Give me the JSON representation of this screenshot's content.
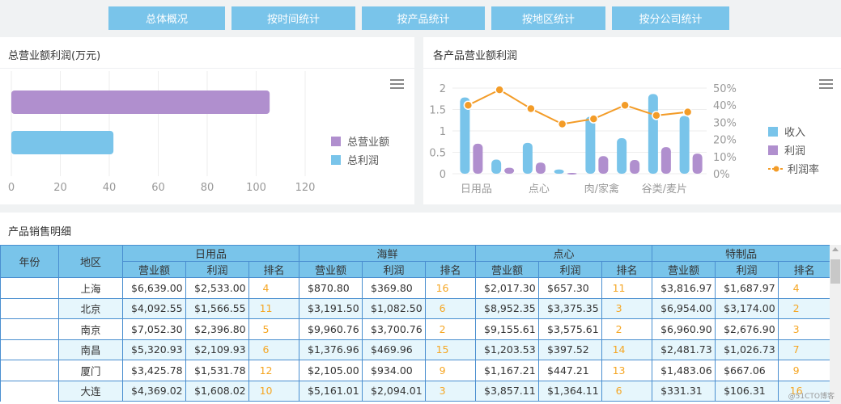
{
  "nav": {
    "buttons": [
      "总体概况",
      "按时间统计",
      "按产品统计",
      "按地区统计",
      "按分公司统计"
    ]
  },
  "left_panel": {
    "title": "总营业额利润(万元)"
  },
  "right_panel": {
    "title": "各产品营业额利润"
  },
  "table_panel": {
    "title": "产品销售明细"
  },
  "chart_data": [
    {
      "type": "bar",
      "orientation": "horizontal",
      "title": "总营业额利润(万元)",
      "categories": [
        "总营业额",
        "总利润"
      ],
      "values": [
        105.5,
        41.7
      ],
      "colors": [
        "#b08fce",
        "#79c4ea"
      ],
      "xlim": [
        0,
        120
      ],
      "x_ticks": [
        "0",
        "20",
        "40",
        "60",
        "80",
        "100",
        "120"
      ],
      "legend": [
        "总营业额",
        "总利润"
      ],
      "legend_position": "right",
      "grid": true
    },
    {
      "type": "bar",
      "title": "各产品营业额利润",
      "categories": [
        "日用品",
        "",
        "点心",
        "",
        "肉/家禽",
        "",
        "谷类/麦片",
        ""
      ],
      "series": [
        {
          "name": "收入",
          "type": "bar",
          "axis": "left",
          "color": "#79c4ea",
          "values": [
            1.78,
            0.33,
            0.72,
            0.1,
            1.33,
            0.83,
            1.86,
            1.35
          ]
        },
        {
          "name": "利润",
          "type": "bar",
          "axis": "left",
          "color": "#b08fce",
          "values": [
            0.7,
            0.14,
            0.26,
            0.02,
            0.41,
            0.32,
            0.62,
            0.47
          ]
        },
        {
          "name": "利润率",
          "type": "line",
          "axis": "right",
          "color": "#f39c28",
          "values": [
            40,
            49,
            38,
            29,
            32,
            40,
            34,
            36
          ]
        }
      ],
      "ylim_left": [
        0,
        2
      ],
      "y_ticks_left": [
        "0",
        "0.5",
        "1",
        "1.5",
        "2"
      ],
      "ylim_right": [
        0,
        50
      ],
      "y_ticks_right": [
        "0%",
        "10%",
        "20%",
        "30%",
        "40%",
        "50%"
      ],
      "legend": [
        "收入",
        "利润",
        "利润率"
      ],
      "legend_position": "right",
      "grid": true
    }
  ],
  "table": {
    "header_year": "年份",
    "header_region": "地区",
    "groups": [
      "日用品",
      "海鲜",
      "点心",
      "特制品"
    ],
    "sub_headers": [
      "营业额",
      "利润",
      "排名"
    ],
    "rows": [
      {
        "region": "上海",
        "cells": [
          [
            "$6,639.00",
            "$2,533.00",
            "4"
          ],
          [
            "$870.80",
            "$369.80",
            "16"
          ],
          [
            "$2,017.30",
            "$657.30",
            "11"
          ],
          [
            "$3,816.97",
            "$1,687.97",
            "4"
          ]
        ]
      },
      {
        "region": "北京",
        "cells": [
          [
            "$4,092.55",
            "$1,566.55",
            "11"
          ],
          [
            "$3,191.50",
            "$1,082.50",
            "6"
          ],
          [
            "$8,952.35",
            "$3,375.35",
            "3"
          ],
          [
            "$6,954.00",
            "$3,174.00",
            "2"
          ]
        ]
      },
      {
        "region": "南京",
        "cells": [
          [
            "$7,052.30",
            "$2,396.80",
            "5"
          ],
          [
            "$9,960.76",
            "$3,700.76",
            "2"
          ],
          [
            "$9,155.61",
            "$3,575.61",
            "2"
          ],
          [
            "$6,960.90",
            "$2,676.90",
            "3"
          ]
        ]
      },
      {
        "region": "南昌",
        "cells": [
          [
            "$5,320.93",
            "$2,109.93",
            "6"
          ],
          [
            "$1,376.96",
            "$469.96",
            "15"
          ],
          [
            "$1,203.53",
            "$397.52",
            "14"
          ],
          [
            "$2,481.73",
            "$1,026.73",
            "7"
          ]
        ]
      },
      {
        "region": "厦门",
        "cells": [
          [
            "$3,425.78",
            "$1,531.78",
            "12"
          ],
          [
            "$2,105.00",
            "$934.00",
            "9"
          ],
          [
            "$1,167.21",
            "$447.21",
            "13"
          ],
          [
            "$1,483.06",
            "$667.06",
            "9"
          ]
        ]
      },
      {
        "region": "大连",
        "cells": [
          [
            "$4,369.02",
            "$1,608.02",
            "10"
          ],
          [
            "$5,161.01",
            "$2,094.01",
            "3"
          ],
          [
            "$3,857.11",
            "$1,364.11",
            "6"
          ],
          [
            "$331.31",
            "$106.31",
            "16"
          ]
        ]
      }
    ]
  },
  "watermark": "@51CTO博客"
}
